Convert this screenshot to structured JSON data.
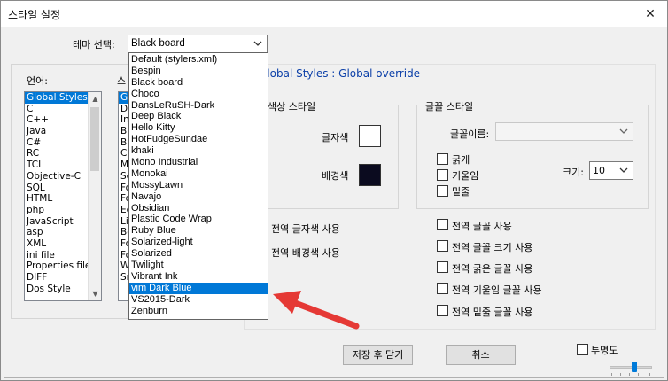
{
  "window": {
    "title": "스타일 설정",
    "close": "✕"
  },
  "theme": {
    "label": "테마 선택:",
    "selected": "Black board"
  },
  "theme_options": [
    "Default (stylers.xml)",
    "Bespin",
    "Black board",
    "Choco",
    "DansLeRuSH-Dark",
    "Deep Black",
    "Hello Kitty",
    "HotFudgeSundae",
    "khaki",
    "Mono Industrial",
    "Monokai",
    "MossyLawn",
    "Navajo",
    "Obsidian",
    "Plastic Code Wrap",
    "Ruby Blue",
    "Solarized-light",
    "Solarized",
    "Twilight",
    "Vibrant Ink",
    "vim Dark Blue",
    "VS2015-Dark",
    "Zenburn"
  ],
  "highlighted_option": "vim Dark Blue",
  "language": {
    "label": "언어:",
    "items": [
      "Global Styles",
      "C",
      "C++",
      "Java",
      "C#",
      "RC",
      "TCL",
      "Objective-C",
      "SQL",
      "HTML",
      "php",
      "JavaScript",
      "asp",
      "XML",
      "ini file",
      "Properties file",
      "DIFF",
      "Dos Style"
    ],
    "selected": "Global Styles"
  },
  "style": {
    "label": "스",
    "letters": [
      "G",
      "D",
      "In",
      "Br",
      "Ba",
      "C",
      "M",
      "Se",
      "Fo",
      "Fo",
      "Ed",
      "Lir",
      "Bo",
      "Fo",
      "Fo",
      "W",
      "Sr"
    ]
  },
  "header": "Global Styles : Global override",
  "color_style": {
    "title": "색상 스타일",
    "fg_label": "글자색",
    "bg_label": "배경색",
    "fg_color": "#ffffff",
    "bg_color": "#0b0b1f"
  },
  "font_style": {
    "title": "글꼴 스타일",
    "name_label": "글꼴이름:",
    "name_value": "",
    "bold": "굵게",
    "italic": "기울임",
    "underline": "밑줄",
    "size_label": "크기:",
    "size_value": "10"
  },
  "global_options": {
    "fg": "전역 글자색 사용",
    "bg": "전역 배경색 사용",
    "font": "전역 글꼴 사용",
    "font_size": "전역 글꼴 크기 사용",
    "bold": "전역 굵은 글꼴 사용",
    "italic": "전역 기울임 글꼴 사용",
    "underline": "전역 밑줄 글꼴 사용"
  },
  "buttons": {
    "save": "저장 후 닫기",
    "cancel": "취소"
  },
  "transparency": {
    "label": "투명도"
  },
  "arrow_color": "#e53935"
}
